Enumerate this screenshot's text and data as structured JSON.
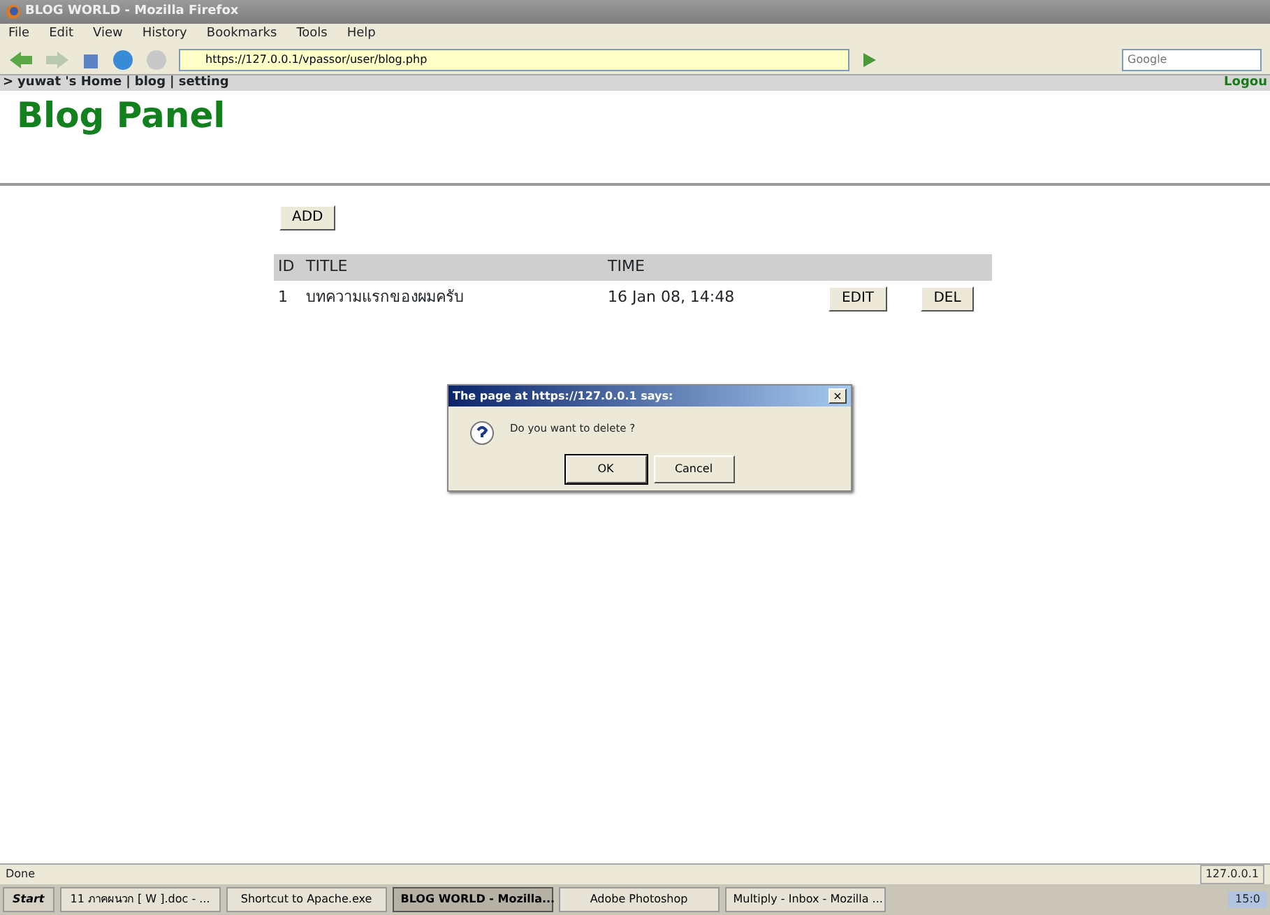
{
  "window": {
    "title": "BLOG WORLD - Mozilla Firefox"
  },
  "menu": [
    "File",
    "Edit",
    "View",
    "History",
    "Bookmarks",
    "Tools",
    "Help"
  ],
  "address": {
    "value": "https://127.0.0.1/vpassor/user/blog.php"
  },
  "search": {
    "placeholder": "Google"
  },
  "site_nav": {
    "prefix": ">",
    "links": [
      "yuwat 's Home",
      "blog",
      "setting"
    ],
    "separator": "|",
    "logout": "Logou"
  },
  "heading": "Blog Panel",
  "add_button": "ADD",
  "table": {
    "columns": [
      "ID",
      "TITLE",
      "TIME",
      "",
      ""
    ],
    "rows": [
      {
        "id": "1",
        "title": "บทความแรกของผมครับ",
        "time": "16 Jan 08, 14:48",
        "edit": "EDIT",
        "del": "DEL"
      }
    ]
  },
  "dialog": {
    "title": "The page at https://127.0.0.1 says:",
    "close": "×",
    "message": "Do you want to delete ?",
    "buttons": [
      "OK",
      "Cancel"
    ]
  },
  "status_bar": {
    "text": "Done",
    "host": "127.0.0.1"
  },
  "taskbar": {
    "start": "Start",
    "items": [
      {
        "label": "11 ภาคผนวก [ W ].doc - ...",
        "selected": false
      },
      {
        "label": "Shortcut to Apache.exe",
        "selected": false
      },
      {
        "label": "BLOG WORLD - Mozilla...",
        "selected": true
      },
      {
        "label": "Adobe Photoshop",
        "selected": false
      },
      {
        "label": "Multiply - Inbox - Mozilla ...",
        "selected": false
      }
    ],
    "clock": "15:0"
  }
}
